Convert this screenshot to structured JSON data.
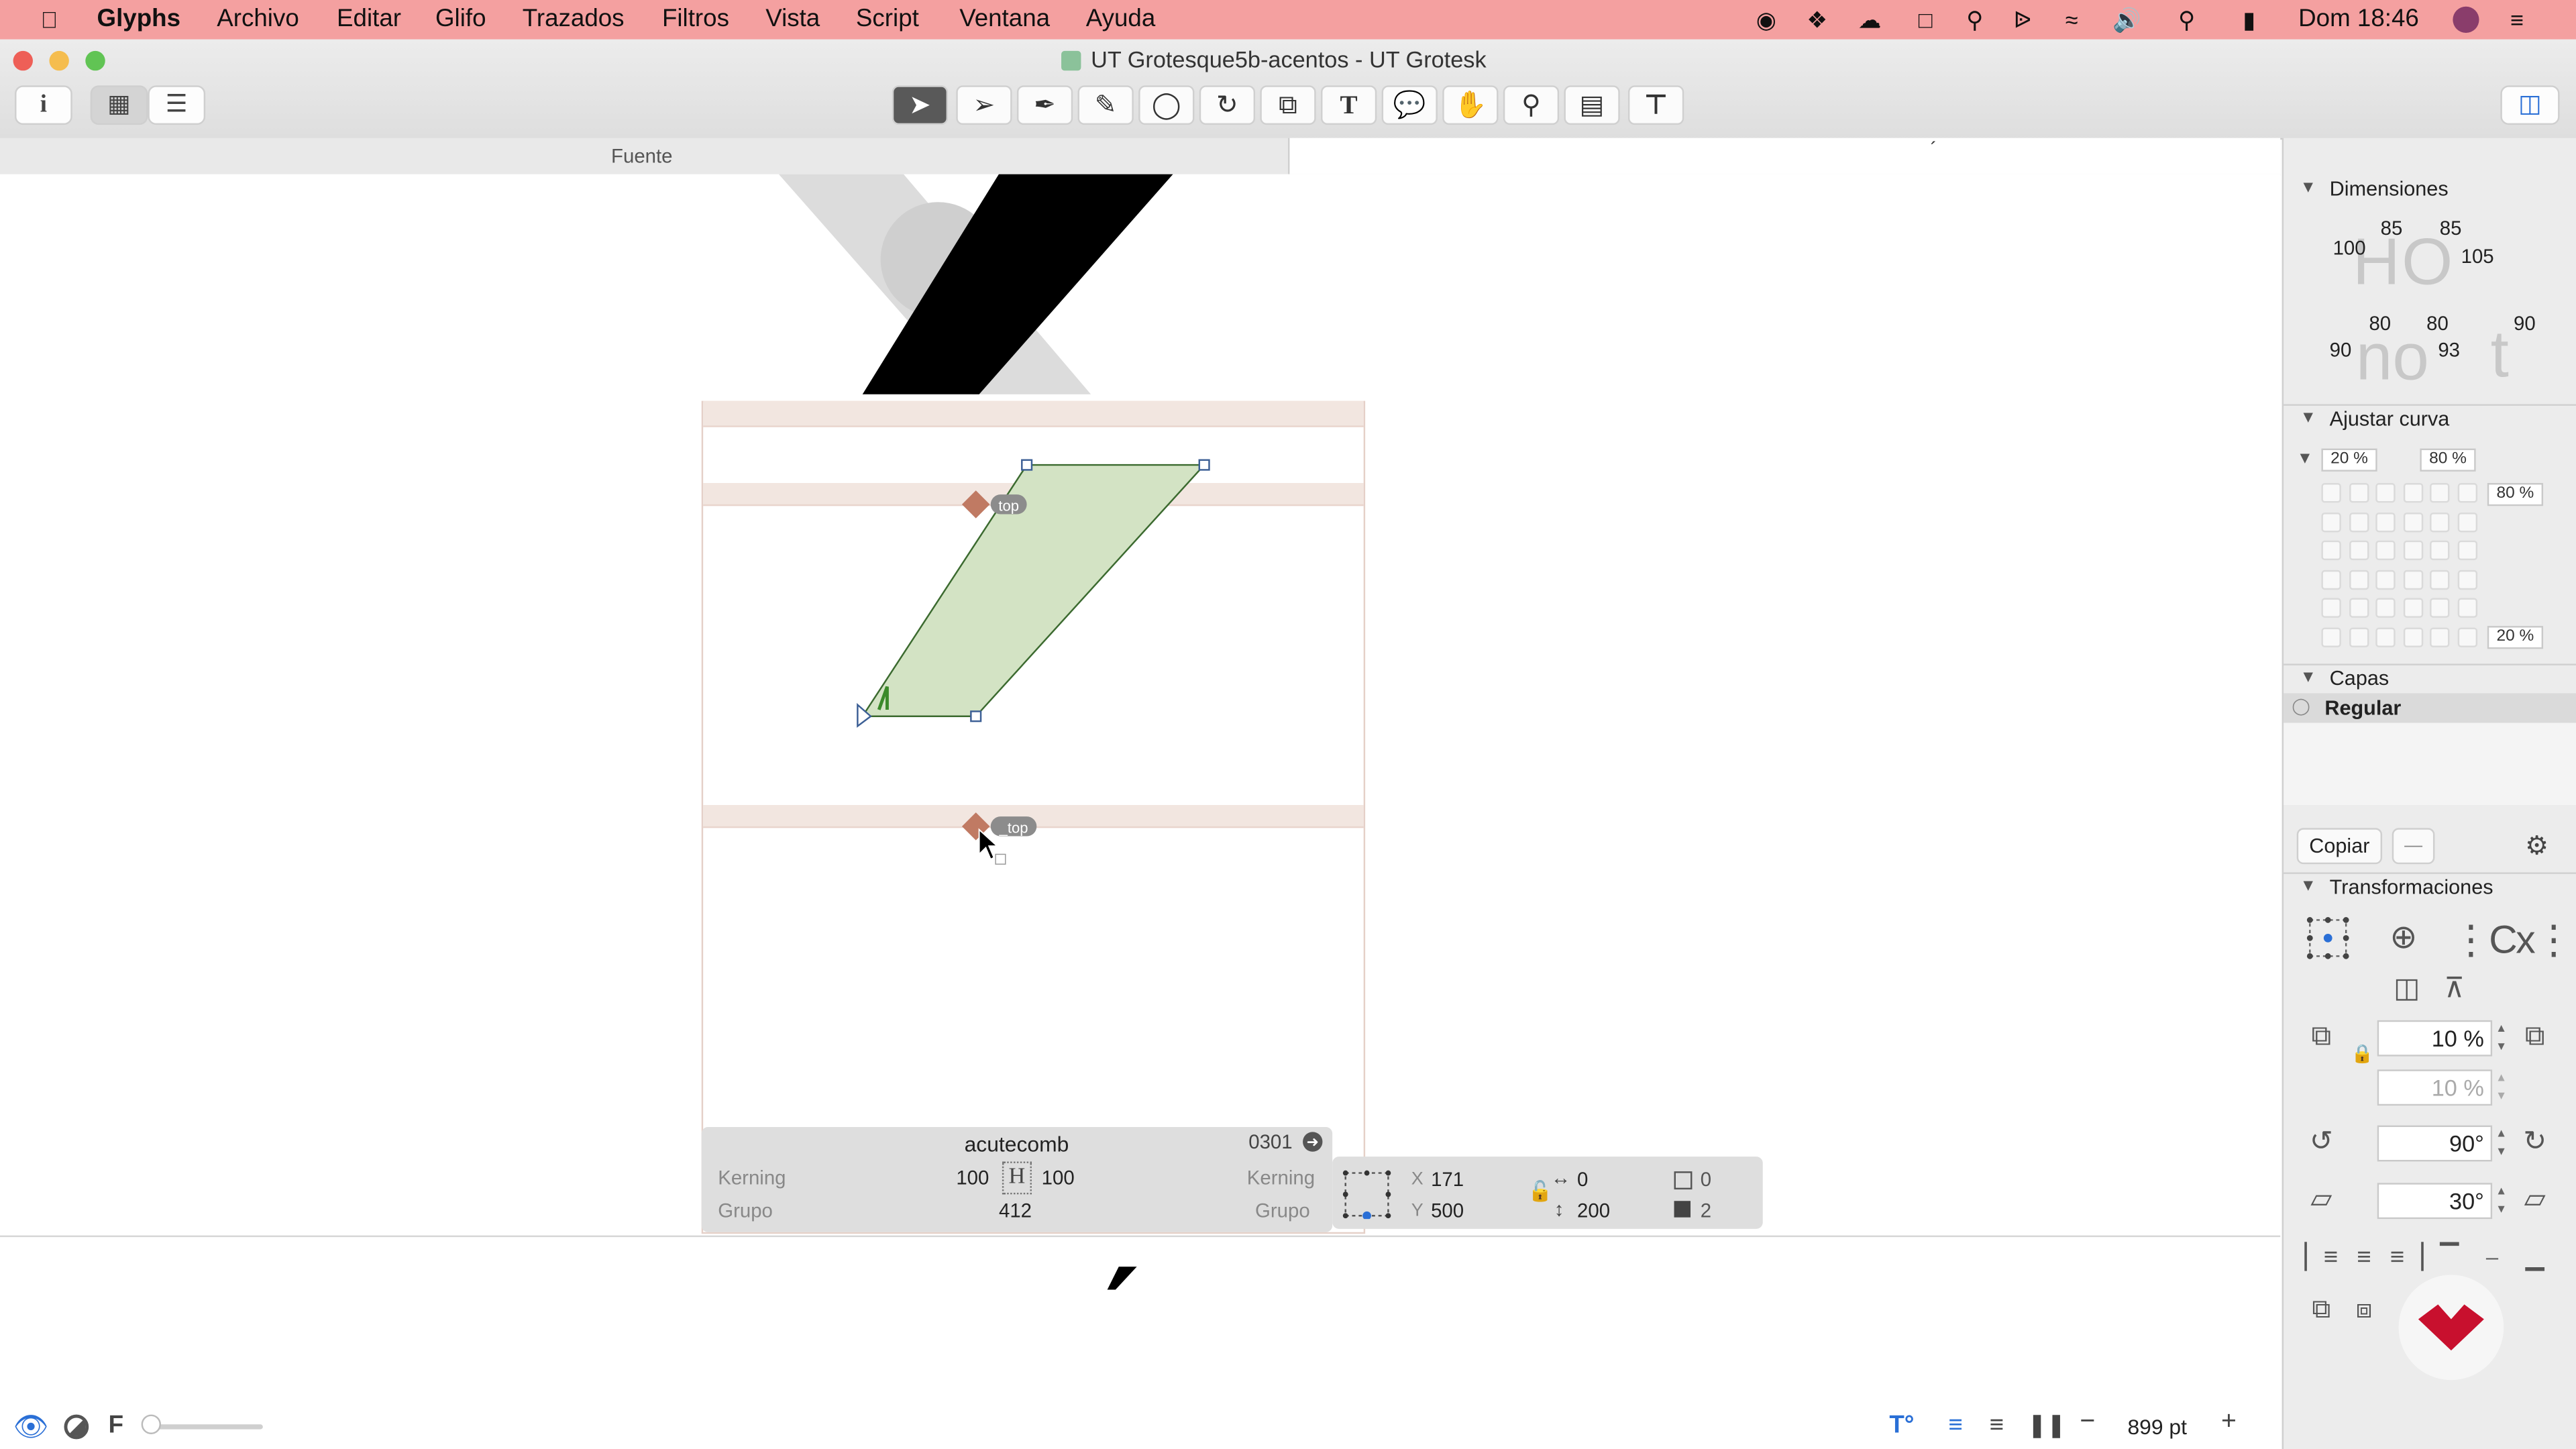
{
  "menubar": {
    "apple": "",
    "app": "Glyphs",
    "items": [
      "Archivo",
      "Editar",
      "Glifo",
      "Trazados",
      "Filtros",
      "Vista",
      "Script",
      "Ventana",
      "Ayuda"
    ],
    "clock": "Dom 18:46"
  },
  "window": {
    "title": "UT Grotesque5b-acentos - UT Grotesk",
    "tab_font": "Fuente",
    "tab_edit": "´"
  },
  "glyph_info": {
    "name": "acutecomb",
    "unicode": "0301",
    "kerning_label": "Kerning",
    "group_label": "Grupo",
    "lsb": "100",
    "rsb": "100",
    "width": "412",
    "kerning_label_right": "Kerning",
    "group_label_right": "Grupo"
  },
  "selection_info": {
    "x_label": "X",
    "x": "171",
    "y_label": "Y",
    "y": "500",
    "w": "0",
    "h": "200",
    "count_a": "0",
    "count_b": "2"
  },
  "anchors": {
    "top": "top",
    "bottom": "_top"
  },
  "bottom_bar": {
    "zoom": "899 pt",
    "minus": "−",
    "plus": "+",
    "f_label": "F"
  },
  "sidebar": {
    "dimensions": {
      "title": "Dimensiones",
      "h_letters": "HO",
      "o_letters": "no",
      "t_letter": "t",
      "v100": "100",
      "v85a": "85",
      "v85b": "85",
      "v105": "105",
      "v90a": "90",
      "v80a": "80",
      "v80b": "80",
      "v93": "93",
      "v90b": "90"
    },
    "curve": {
      "title": "Ajustar curva",
      "left_pct": "20 %",
      "right_pct": "80 %",
      "top_pct": "80 %",
      "bottom_pct": "20 %"
    },
    "layers": {
      "title": "Capas",
      "active": "Regular",
      "copy_button": "Copiar",
      "remove_button": "—"
    },
    "transform": {
      "title": "Transformaciones",
      "scale_x": "10 %",
      "scale_y": "10 %",
      "rotate": "90°",
      "slant": "30°",
      "cx": "Cx"
    }
  },
  "colors": {
    "menubar": "#f4a0a0",
    "path_fill": "#d3e3c4",
    "path_stroke": "#3b6a2f",
    "anchor": "#c07a63",
    "metric_band": "#f2e6e0"
  }
}
